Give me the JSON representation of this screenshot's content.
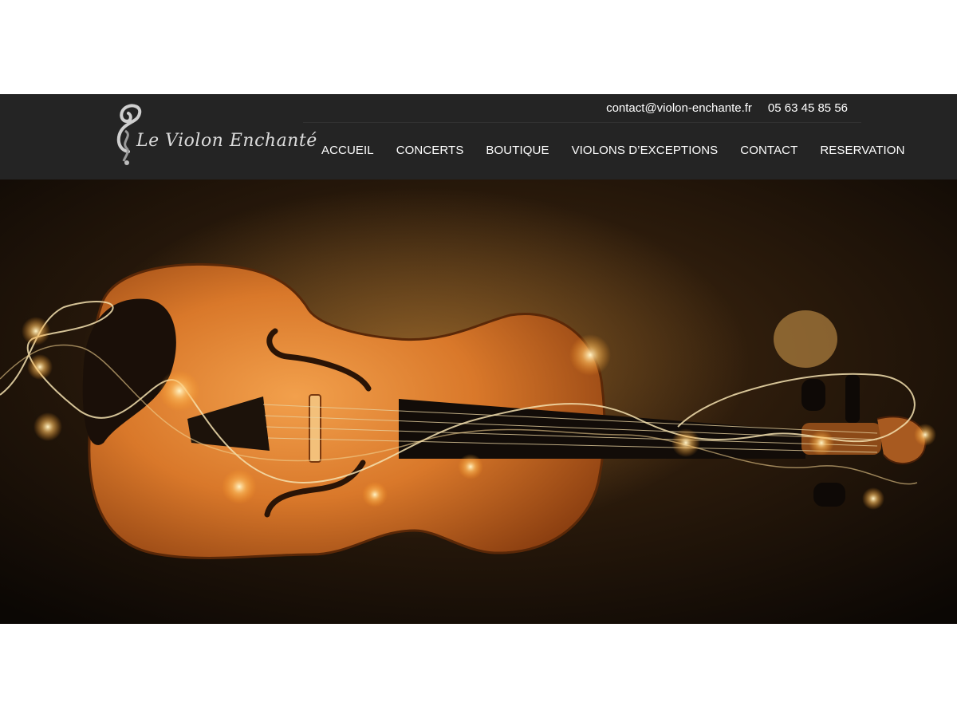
{
  "header": {
    "email": "contact@violon-enchante.fr",
    "phone": "05 63 45 85 56",
    "logo_text": "Le Violon Enchanté"
  },
  "nav": {
    "items": [
      {
        "label": "ACCUEIL"
      },
      {
        "label": "CONCERTS"
      },
      {
        "label": "BOUTIQUE"
      },
      {
        "label": "VIOLONS D’EXCEPTIONS"
      },
      {
        "label": "CONTACT"
      },
      {
        "label": "RESERVATION"
      }
    ]
  },
  "hero": {
    "image": "violin-with-fairy-lights"
  },
  "colors": {
    "header_bg": "#242424",
    "nav_text": "#ffffff",
    "violin_wood": "#d9782a"
  }
}
